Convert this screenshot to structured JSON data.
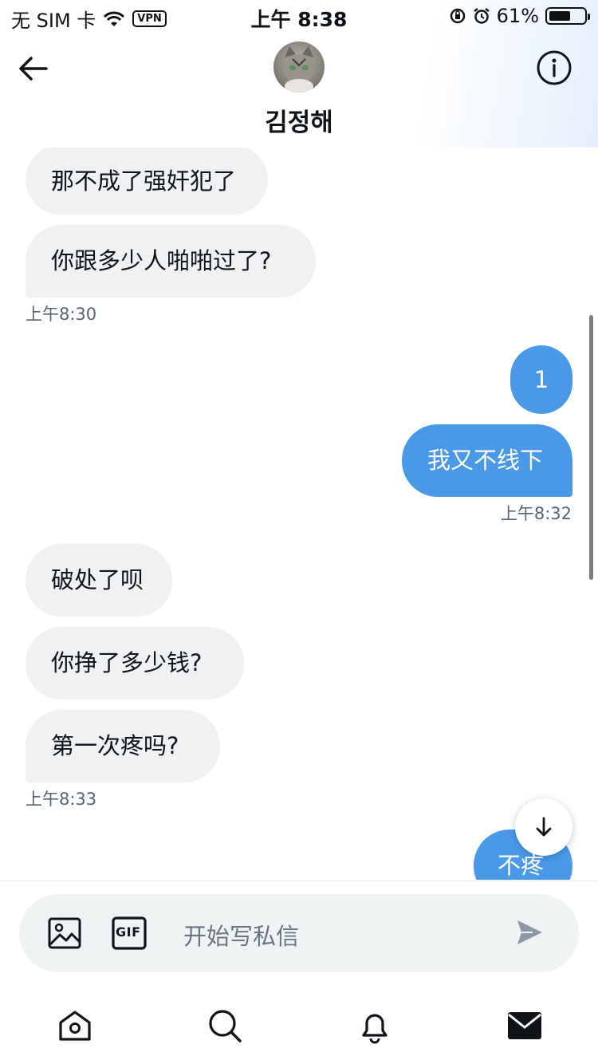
{
  "status_bar": {
    "carrier": "无 SIM 卡",
    "vpn": "VPN",
    "time": "上午 8:38",
    "battery_text": "61%",
    "battery_level": 0.61
  },
  "header": {
    "contact_name": "김정해",
    "icons": [
      "arrow-left-icon",
      "info-icon"
    ]
  },
  "messages": {
    "group1": {
      "bubbles": [
        "那不成了强奸犯了",
        "你跟多少人啪啪过了?"
      ],
      "time": "上午8:30"
    },
    "group2": {
      "bubbles": [
        "1",
        "我又不线下"
      ],
      "time": "上午8:32"
    },
    "group3": {
      "bubbles": [
        "破处了呗",
        "你挣了多少钱?",
        "第一次疼吗?"
      ],
      "time": "上午8:33"
    },
    "group4": {
      "bubbles": [
        "不疼"
      ]
    }
  },
  "composer": {
    "placeholder": "开始写私信",
    "gif_label": "GIF"
  },
  "tabbar": {
    "items": [
      "home-icon",
      "search-icon",
      "bell-icon",
      "mail-icon"
    ]
  },
  "colors": {
    "outgoing_bubble": "#4a99e9",
    "incoming_bubble": "#eff1f3",
    "timestamp": "#536471"
  }
}
